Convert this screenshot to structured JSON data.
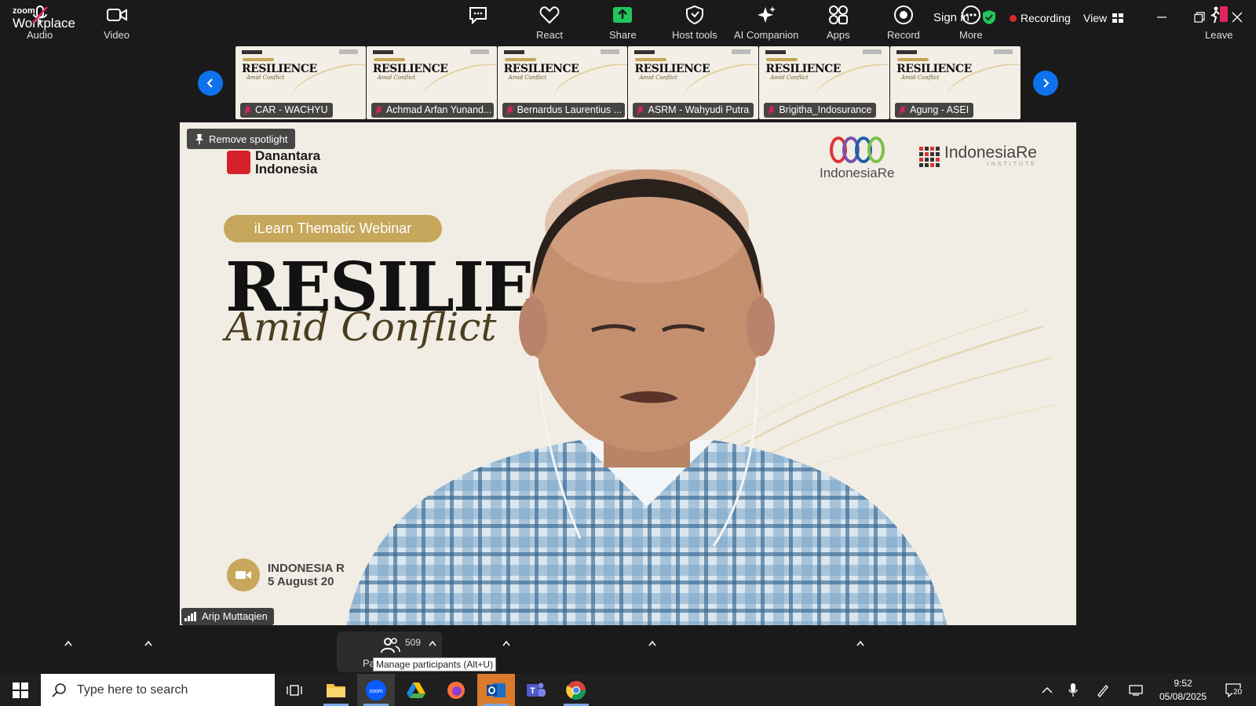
{
  "app": {
    "brand_small": "zoom",
    "brand_large": "Workplace"
  },
  "titlebar": {
    "sign_in": "Sign in",
    "recording": "Recording",
    "view": "View"
  },
  "thumbnails": [
    {
      "name": "CAR - WACHYU",
      "slide_title": "RESILIENCE",
      "slide_sub": "Amid Conflict"
    },
    {
      "name": "Achmad Arfan Yunand...",
      "slide_title": "RESILIENCE",
      "slide_sub": "Amid Conflict"
    },
    {
      "name": "Bernardus Laurentius ...",
      "slide_title": "RESILIENCE",
      "slide_sub": "Amid Conflict"
    },
    {
      "name": "ASRM - Wahyudi Putra",
      "slide_title": "RESILIENCE",
      "slide_sub": "Amid Conflict"
    },
    {
      "name": "Brigitha_Indosurance",
      "slide_title": "RESILIENCE",
      "slide_sub": "Amid Conflict"
    },
    {
      "name": "Agung - ASEI",
      "slide_title": "RESILIENCE",
      "slide_sub": "Amid Conflict"
    }
  ],
  "main_video": {
    "remove_spotlight": "Remove spotlight",
    "speaker_name": "Arip Muttaqien",
    "slide": {
      "org_logo_line1": "Danantara",
      "org_logo_line2": "Indonesia",
      "partner_logo": "IndonesiaRe",
      "institute_logo": "IndonesiaRe",
      "institute_sub": "INSTITUTE",
      "badge": "iLearn Thematic Webinar",
      "title": "RESILIEN",
      "subtitle": "Amid Conflict",
      "footer_line1": "INDONESIA R",
      "footer_line2": "5 August 20"
    }
  },
  "toolbar": {
    "audio": "Audio",
    "video": "Video",
    "participants_label": "Pa",
    "participants_count": "509",
    "tooltip": "Manage participants (Alt+U)",
    "react": "React",
    "share": "Share",
    "host_tools": "Host tools",
    "ai_companion": "AI Companion",
    "apps": "Apps",
    "record": "Record",
    "more": "More",
    "leave": "Leave"
  },
  "taskbar": {
    "search_placeholder": "Type here to search",
    "time": "9:52",
    "date": "05/08/2025",
    "notifications": "20"
  },
  "colors": {
    "accent": "#0e72ed",
    "recording": "#e02828",
    "share": "#23c55e",
    "gold": "#c6a75b"
  }
}
